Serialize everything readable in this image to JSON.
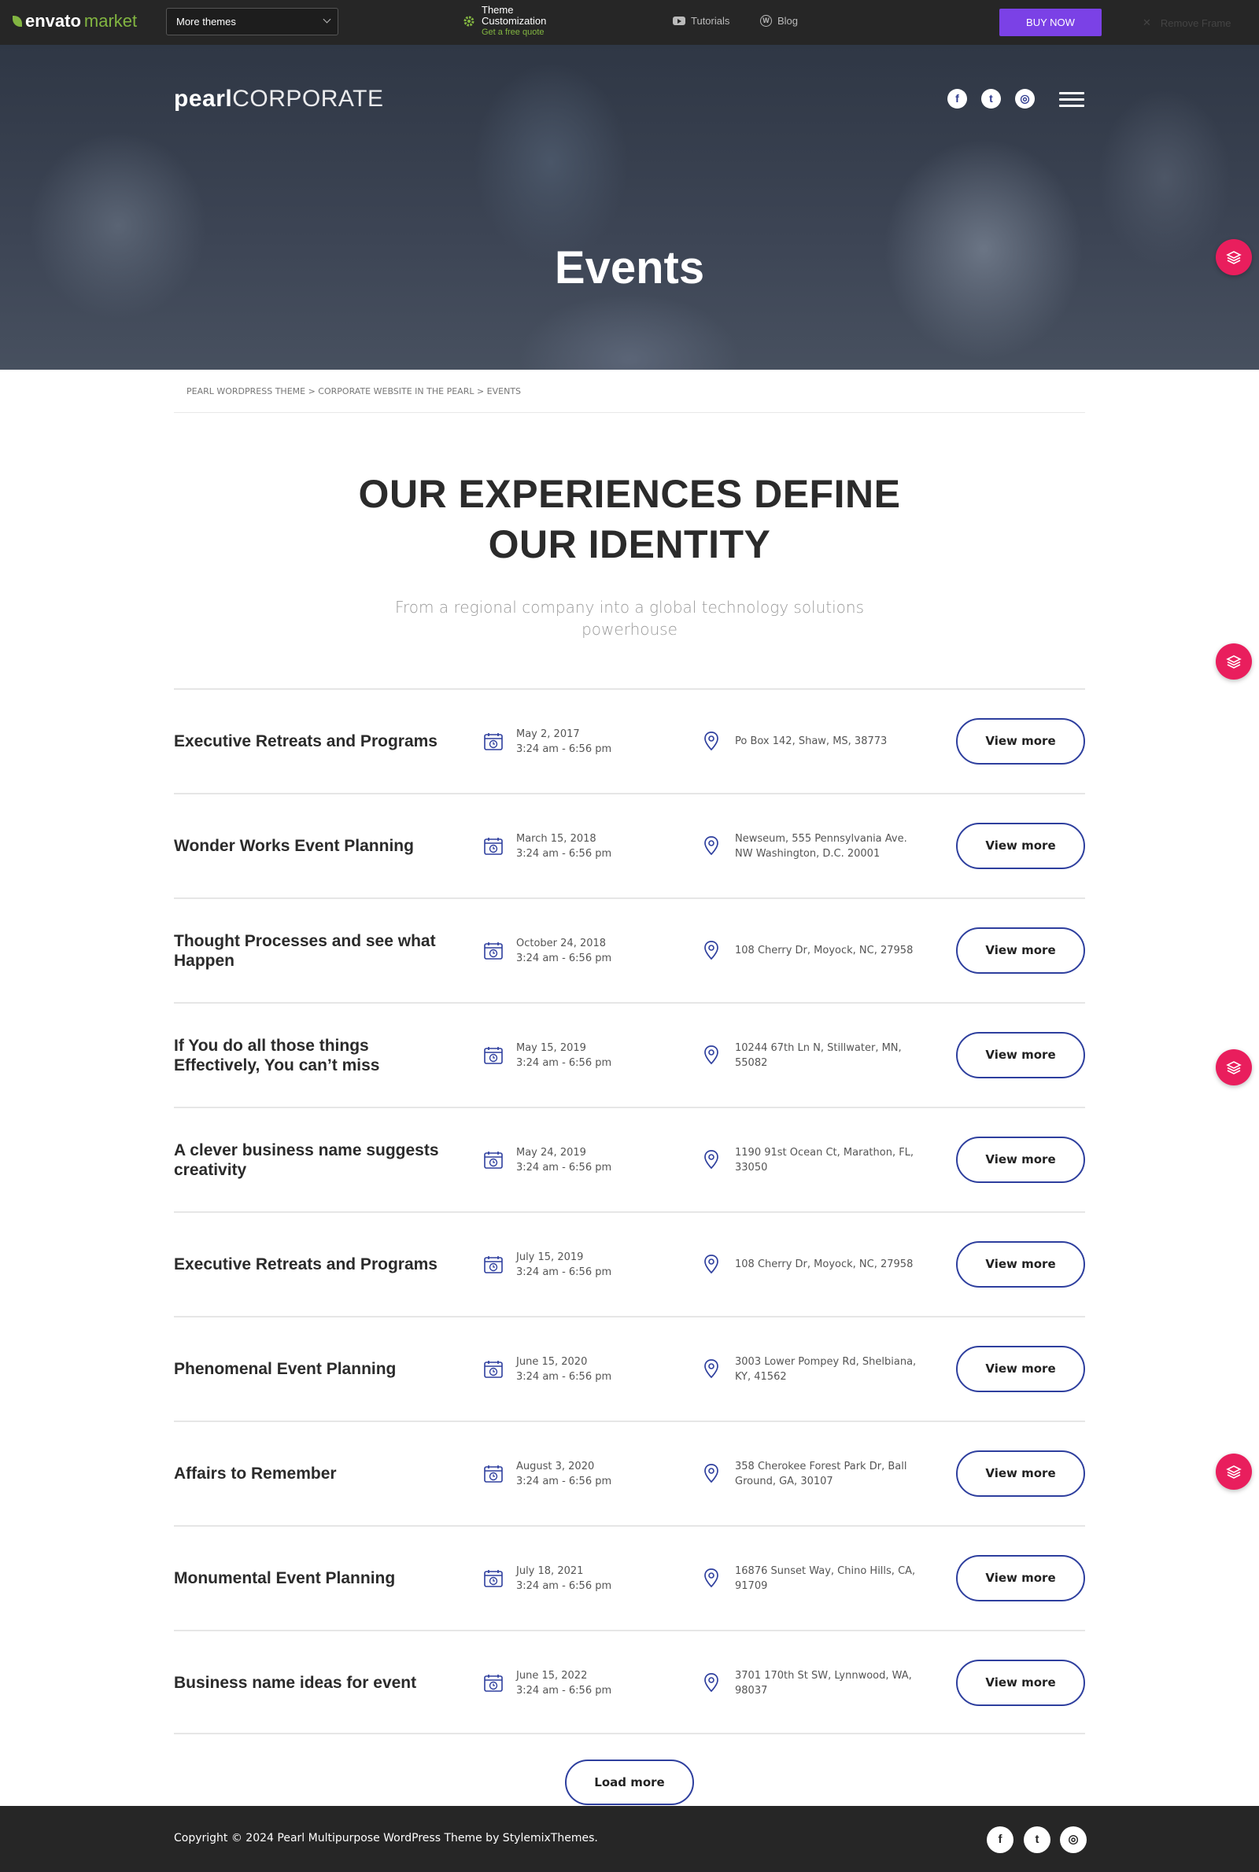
{
  "envato_bar": {
    "logo_text": "envato",
    "logo_market": "market",
    "themes_select": "More themes",
    "theme_customization": "Theme Customization",
    "free_quote": "Get a free quote",
    "tutorials": "Tutorials",
    "blog": "Blog",
    "buy_now": "BUY NOW",
    "remove_frame": "Remove Frame"
  },
  "hero": {
    "logo_bold": "pearl",
    "logo_light": "CORPORATE",
    "social": [
      "f",
      "t",
      "◎"
    ],
    "title": "Events"
  },
  "breadcrumb": "PEARL WORDPRESS THEME > CORPORATE WEBSITE IN THE PEARL > EVENTS",
  "section": {
    "title_line1": "OUR EXPERIENCES DEFINE",
    "title_line2": "OUR IDENTITY",
    "subtitle": "From a regional company into a global technology solutions powerhouse"
  },
  "events": [
    {
      "title": "Executive Retreats and Programs",
      "date": "May 2, 2017",
      "time": "3:24 am - 6:56 pm",
      "location": "Po Box 142, Shaw, MS, 38773",
      "button": "View more"
    },
    {
      "title": "Wonder Works Event Planning",
      "date": "March 15, 2018",
      "time": "3:24 am - 6:56 pm",
      "location": "Newseum, 555 Pennsylvania Ave. NW Washington, D.C. 20001",
      "button": "View more"
    },
    {
      "title": "Thought Processes and see what Happen",
      "date": "October 24, 2018",
      "time": "3:24 am - 6:56 pm",
      "location": "108 Cherry Dr, Moyock, NC, 27958",
      "button": "View more"
    },
    {
      "title": "If You do all those things Effectively, You can’t miss",
      "date": "May 15, 2019",
      "time": "3:24 am - 6:56 pm",
      "location": "10244 67th Ln N, Stillwater, MN, 55082",
      "button": "View more"
    },
    {
      "title": "A clever business name suggests creativity",
      "date": "May 24, 2019",
      "time": "3:24 am - 6:56 pm",
      "location": "1190 91st Ocean Ct, Marathon, FL, 33050",
      "button": "View more"
    },
    {
      "title": "Executive Retreats and Programs",
      "date": "July 15, 2019",
      "time": "3:24 am - 6:56 pm",
      "location": "108 Cherry Dr, Moyock, NC, 27958",
      "button": "View more"
    },
    {
      "title": "Phenomenal Event Planning",
      "date": "June 15, 2020",
      "time": "3:24 am - 6:56 pm",
      "location": "3003 Lower Pompey Rd, Shelbiana, KY, 41562",
      "button": "View more"
    },
    {
      "title": "Affairs to Remember",
      "date": "August 3, 2020",
      "time": "3:24 am - 6:56 pm",
      "location": "358 Cherokee Forest Park Dr, Ball Ground, GA, 30107",
      "button": "View more"
    },
    {
      "title": "Monumental Event Planning",
      "date": "July 18, 2021",
      "time": "3:24 am - 6:56 pm",
      "location": "16876 Sunset Way, Chino Hills, CA, 91709",
      "button": "View more"
    },
    {
      "title": "Business name ideas for event",
      "date": "June 15, 2022",
      "time": "3:24 am - 6:56 pm",
      "location": "3701 170th St SW, Lynnwood, WA, 98037",
      "button": "View more"
    }
  ],
  "load_more": "Load more",
  "footer": {
    "copyright": "Copyright © 2024 Pearl Multipurpose WordPress Theme by StylemixThemes.",
    "social": [
      "f",
      "t",
      "◎"
    ]
  },
  "colors": {
    "accent_blue": "#2e3f9e",
    "buy_purple": "#7b41e6",
    "widget_pink": "#e91e5d",
    "envato_green": "#82b541",
    "dark_bar": "#262626"
  },
  "icons": {
    "date": "calendar-clock-icon",
    "location": "map-pin-icon",
    "side_widget": "layers-icon"
  }
}
